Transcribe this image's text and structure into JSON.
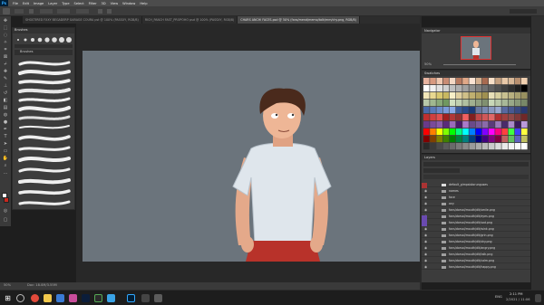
{
  "menubar": {
    "app_icon": "Ps",
    "items": [
      "File",
      "Edit",
      "Image",
      "Layer",
      "Type",
      "Select",
      "Filter",
      "3D",
      "View",
      "Window",
      "Help"
    ]
  },
  "tabs": [
    {
      "label": "SHGSTIRED FXXY BEGADERP GARAGE COURA pst @ 100% (PASSXY, RGB/8)"
    },
    {
      "label": "RICH_PANCH FAST_PROPOHO psd @ 100% (PASSXY, RGB/8)"
    },
    {
      "label": "CHARS ANCHI FACES.psd @ 50% (fans/mend/memo/talk/mm/chy.png, RGB/8)",
      "active": true
    }
  ],
  "brushes_panel": {
    "title": "Brushes",
    "label": "Brushes"
  },
  "right_panels": {
    "navigator": "Navigator",
    "swatches": "Swatches",
    "layers": "Layers",
    "zoom": "50%"
  },
  "layers": [
    {
      "name": "default_gimpsistorunguses",
      "type": "layer"
    },
    {
      "name": "names",
      "type": "folder"
    },
    {
      "name": "face",
      "type": "folder"
    },
    {
      "name": "any",
      "type": "folder"
    },
    {
      "name": "fans/dorsal/mouth/dlt/smile.png",
      "type": "folder"
    },
    {
      "name": "fans/dorsal/mouth/dlt/eyes.png",
      "type": "folder"
    },
    {
      "name": "fans/dorsal/mouth/dlt/sad.png",
      "type": "folder"
    },
    {
      "name": "fans/dorsal/mouth/dlt/wink.png",
      "type": "folder"
    },
    {
      "name": "fans/dorsal/mouth/dlt/grin.png",
      "type": "folder"
    },
    {
      "name": "fans/dorsal/mouth/dlt/shy.png",
      "type": "folder"
    },
    {
      "name": "fans/dorsal/mouth/dlt/angry.png",
      "type": "folder"
    },
    {
      "name": "fans/dorsal/mouth/dlt/talk.png",
      "type": "folder"
    },
    {
      "name": "fans/dorsal/mouth/dlt/calm.png",
      "type": "folder"
    },
    {
      "name": "fans/dorsal/mouth/dlt/happy.png",
      "type": "folder"
    }
  ],
  "statusbar": {
    "zoom": "50%",
    "doc": "Doc: 18.0M/3.55M"
  },
  "taskbar": {
    "time": "2:11 PM",
    "date": "2/2021 / 11:06",
    "lang": "ENG"
  },
  "colors": {
    "accent": "#31a8ff",
    "canvas_bg": "#6b747c"
  }
}
